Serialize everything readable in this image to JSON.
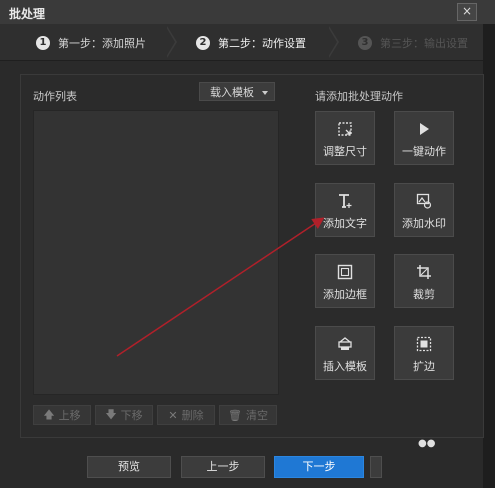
{
  "window": {
    "title": "批处理",
    "close_glyph": "×"
  },
  "steps": [
    {
      "num": "1",
      "label": "第一步：添加照片"
    },
    {
      "num": "2",
      "label": "第二步：动作设置"
    },
    {
      "num": "3",
      "label": "第三步：输出设置"
    }
  ],
  "left": {
    "label": "动作列表",
    "template_dropdown": "载入模板",
    "buttons": [
      {
        "label": "上移",
        "icon": "arrow-up-icon"
      },
      {
        "label": "下移",
        "icon": "arrow-down-icon"
      },
      {
        "label": "删除",
        "icon": "delete-icon"
      },
      {
        "label": "清空",
        "icon": "trash-icon"
      }
    ]
  },
  "right": {
    "label": "请添加批处理动作",
    "actions": [
      {
        "label": "调整尺寸",
        "icon": "resize-icon"
      },
      {
        "label": "一键动作",
        "icon": "play-icon"
      },
      {
        "label": "添加文字",
        "icon": "text-icon"
      },
      {
        "label": "添加水印",
        "icon": "watermark-icon"
      },
      {
        "label": "添加边框",
        "icon": "border-icon"
      },
      {
        "label": "裁剪",
        "icon": "crop-icon"
      },
      {
        "label": "插入模板",
        "icon": "template-icon"
      },
      {
        "label": "扩边",
        "icon": "expand-icon"
      }
    ]
  },
  "footer": {
    "preview": "预览",
    "prev": "上一步",
    "next": "下一步"
  },
  "colors": {
    "primary": "#1f78d4",
    "annotation": "#b0202a"
  }
}
